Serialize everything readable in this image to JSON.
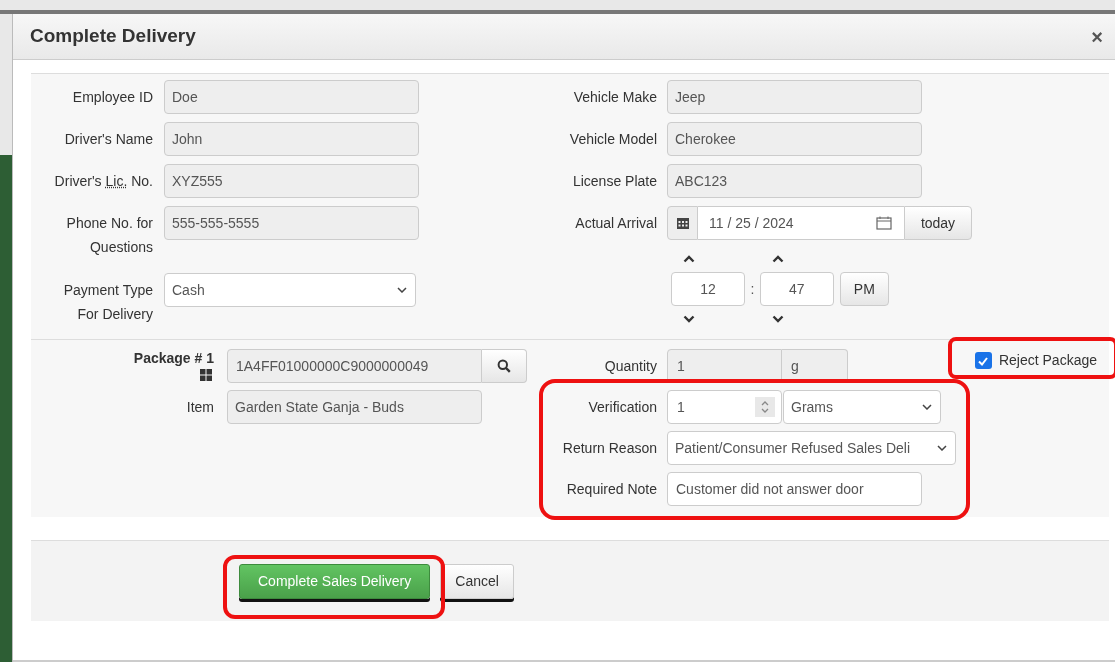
{
  "dialog": {
    "title": "Complete Delivery",
    "close": "×"
  },
  "driver_fields": [
    {
      "label": "Employee ID",
      "value": "Doe",
      "kind": "readonly"
    },
    {
      "label": "Driver's Name",
      "value": "John",
      "kind": "readonly"
    },
    {
      "label": "Driver's",
      "abbr": "Lic.",
      "label_after": "No.",
      "value": "XYZ555",
      "kind": "readonly"
    },
    {
      "label": "Phone No. for Questions",
      "value": "555-555-5555",
      "kind": "readonly"
    },
    {
      "label": "Payment Type For Delivery",
      "value": "Cash",
      "kind": "select"
    }
  ],
  "vehicle_fields": [
    {
      "label": "Vehicle Make",
      "value": "Jeep"
    },
    {
      "label": "Vehicle Model",
      "value": "Cherokee"
    },
    {
      "label": "License Plate",
      "value": "ABC123"
    }
  ],
  "arrival": {
    "label": "Actual Arrival",
    "date": "11 / 25 / 2024",
    "today_button": "today",
    "hour": "12",
    "separator": ":",
    "minute": "47",
    "meridian": "PM"
  },
  "package": {
    "label": "Package # 1",
    "id": "1A4FF01000000C9000000049",
    "item_label": "Item",
    "item": "Garden State Ganja - Buds",
    "quantity_label": "Quantity",
    "quantity": "1",
    "unit": "g",
    "reject": {
      "label": "Reject Package",
      "checked": true,
      "highlighted": true
    }
  },
  "return_details": {
    "highlighted": true,
    "verification_label": "Verification",
    "verification": "1",
    "verification_unit": "Grams",
    "reason_label": "Return Reason",
    "reason": "Patient/Consumer Refused Sales Deli",
    "note_label": "Required Note",
    "note": "Customer did not answer door"
  },
  "buttons": [
    {
      "label": "Complete Sales Delivery",
      "kind": "primary",
      "highlighted": true
    },
    {
      "label": "Cancel",
      "kind": "default"
    }
  ]
}
